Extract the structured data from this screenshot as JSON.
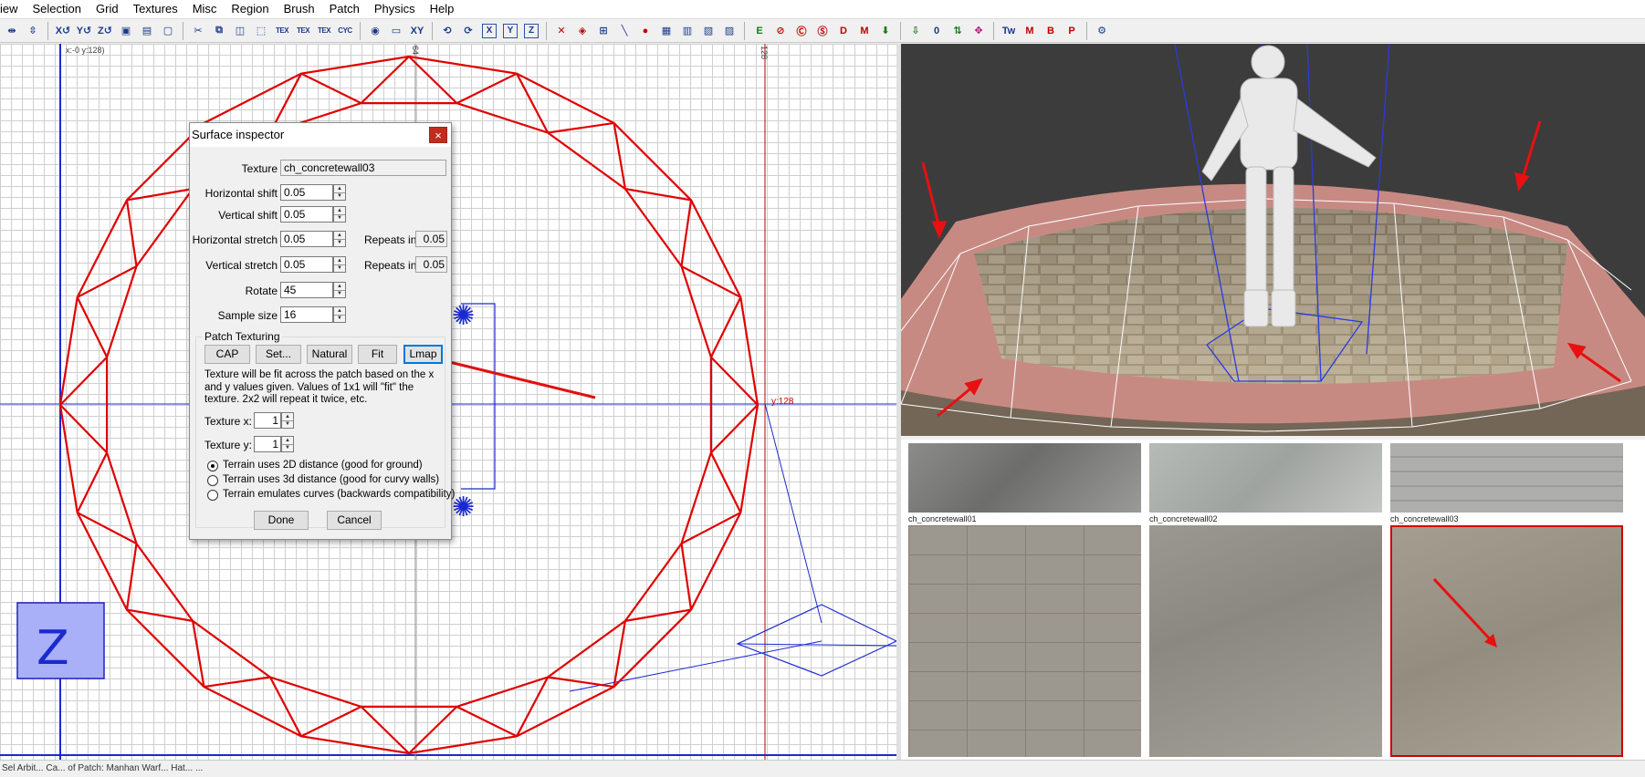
{
  "menu": [
    "iew",
    "Selection",
    "Grid",
    "Textures",
    "Misc",
    "Region",
    "Brush",
    "Patch",
    "Physics",
    "Help"
  ],
  "toolbar_icons": [
    "flip-x-icon",
    "flip-y-icon",
    "rotate-x-icon",
    "rotate-y-icon",
    "rotate-z-icon",
    "csg-subtract-icon",
    "csg-merge-icon",
    "hollow-icon",
    "clip-icon",
    "copy-brush-icon",
    "drag-edges-icon",
    "drag-vertices-icon",
    "select-inside-icon",
    "select-touching-icon",
    "texture-lock-icon",
    "cycle-layer-icon",
    "camera-icon",
    "view-change-icon",
    "xyz-icon",
    "xy-view-icon",
    "x-axis-icon",
    "y-axis-icon",
    "z-axis-icon",
    "patch-icon",
    "bend-icon",
    "cap-icon",
    "thicken-icon",
    "show-entities-icon",
    "clipper-icon",
    "entity-list-icon",
    "filter-icon",
    "no-draw-icon",
    "show-paths-icon",
    "detail-icon",
    "model-icon",
    "light-icon",
    "zero-icon",
    "move-down-icon",
    "swap-icon",
    "tw-icon",
    "m-icon",
    "b-icon",
    "p-icon",
    "plugin-icon"
  ],
  "grid": {
    "coord_top": "x:-0  y:128)",
    "ruler_64": "64",
    "ruler_128": "128",
    "y_label": "y:128"
  },
  "dialog": {
    "title": "Surface inspector",
    "close": "×",
    "texture_label": "Texture",
    "texture_value": "ch_concretewall03",
    "hshift_label": "Horizontal shift",
    "hshift_value": "0.05",
    "vshift_label": "Vertical shift",
    "vshift_value": "0.05",
    "hstretch_label": "Horizontal stretch",
    "hstretch_value": "0.05",
    "repeats_label_1": "Repeats in",
    "repeats_value_1": "0.05",
    "vstretch_label": "Vertical stretch",
    "vstretch_value": "0.05",
    "repeats_label_2": "Repeats in",
    "repeats_value_2": "0.05",
    "rotate_label": "Rotate",
    "rotate_value": "45",
    "sample_label": "Sample size",
    "sample_value": "16",
    "group_label": "Patch Texturing",
    "btn_cap": "CAP",
    "btn_set": "Set...",
    "btn_natural": "Natural",
    "btn_fit": "Fit",
    "btn_lmap": "Lmap",
    "help": "Texture will be fit across the patch based on the x and y values given. Values of 1x1 will \"fit\" the texture. 2x2 will repeat it twice, etc.",
    "texx_label": "Texture x:",
    "texx_value": "1",
    "texy_label": "Texture y:",
    "texy_value": "1",
    "radio_1": "Terrain uses 2D distance (good for ground)",
    "radio_2": "Terrain uses 3d distance (good for curvy walls)",
    "radio_3": "Terrain emulates curves (backwards compatibility)",
    "done": "Done",
    "cancel": "Cancel"
  },
  "textures": [
    "ch_concretewall01",
    "ch_concretewall02",
    "ch_concretewall03"
  ],
  "status": "Sel Arbit...  Ca... of Patch: Manhan Warf... Hat... ...",
  "colors": {
    "brush": "#e00000",
    "entity": "#1010c0",
    "selected": "#c00000"
  }
}
